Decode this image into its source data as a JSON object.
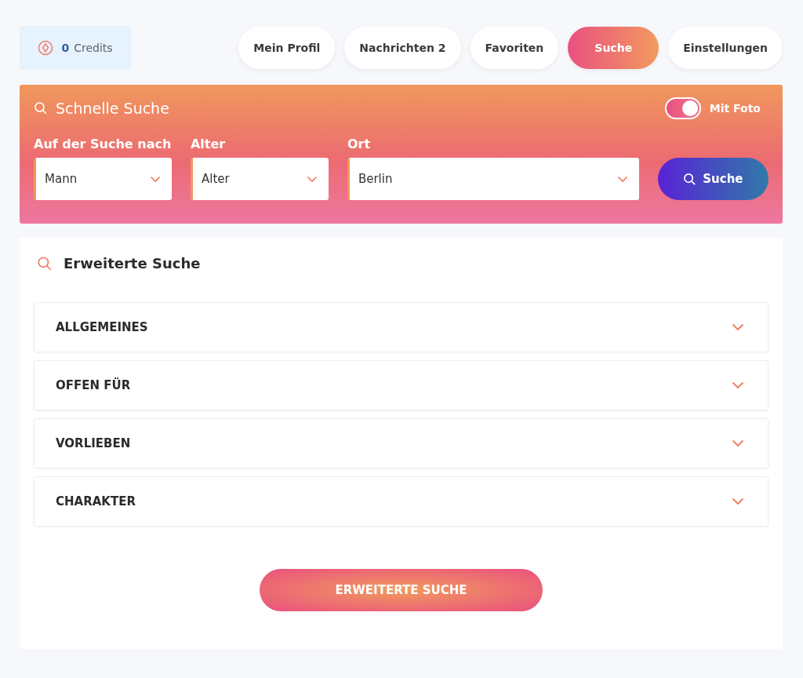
{
  "credits": {
    "count": "0",
    "label": "Credits"
  },
  "nav": [
    {
      "label": "Mein Profil",
      "selected": false
    },
    {
      "label": "Nachrichten 2",
      "selected": false
    },
    {
      "label": "Favoriten",
      "selected": false
    },
    {
      "label": "Suche",
      "selected": true
    },
    {
      "label": "Einstellungen",
      "selected": false
    }
  ],
  "quick_search": {
    "title": "Schnelle Suche",
    "photo_toggle": {
      "label": "Mit Foto",
      "on": true
    },
    "fields": [
      {
        "label": "Auf der Suche nach",
        "value": "Mann"
      },
      {
        "label": "Alter",
        "value": "Alter"
      },
      {
        "label": "Ort",
        "value": "Berlin"
      }
    ],
    "button": "Suche"
  },
  "advanced_search": {
    "title": "Erweiterte Suche",
    "sections": [
      {
        "label": "ALLGEMEINES",
        "expanded": false
      },
      {
        "label": "OFFEN FÜR",
        "expanded": false
      },
      {
        "label": "VORLIEBEN",
        "expanded": false
      },
      {
        "label": "CHARAKTER",
        "expanded": false
      }
    ],
    "button": "ERWEITERTE SUCHE"
  }
}
